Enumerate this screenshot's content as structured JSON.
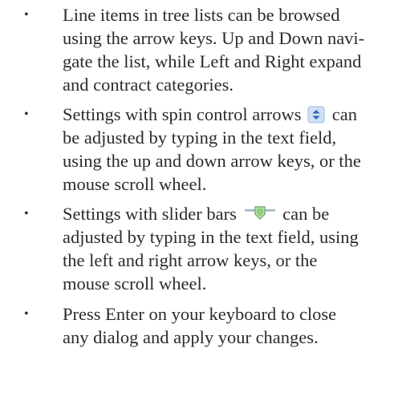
{
  "bullet_symbol": "•",
  "items": [
    {
      "lines": [
        "Line items in tree lists can be browsed",
        "using the arrow keys. Up and Down navi-",
        "gate the list, while Left and Right expand",
        "and contract categories."
      ]
    },
    {
      "line1_before_icon": "Settings with spin control arrows",
      "line1_after_icon": "can",
      "icon": "spin-control-arrows-icon",
      "lines": [
        "be adjusted by typing in the text field,",
        "using the up and down arrow keys, or the",
        "mouse scroll wheel."
      ]
    },
    {
      "line1_before_icon": "Settings with slider bars",
      "line1_after_icon": "can be",
      "icon": "slider-bar-icon",
      "lines": [
        "adjusted by typing in the text field, using",
        "the left and right arrow keys, or the",
        "mouse scroll wheel."
      ]
    },
    {
      "lines": [
        "Press Enter on your keyboard to close",
        "any dialog and apply your changes."
      ]
    }
  ],
  "colors": {
    "text": "#2b2b2b",
    "spin_icon_fill": "#cfe0f5",
    "spin_icon_arrows": "#2f63b7",
    "slider_track": "#9ab6c9",
    "slider_thumb": "#8fcf7a"
  }
}
